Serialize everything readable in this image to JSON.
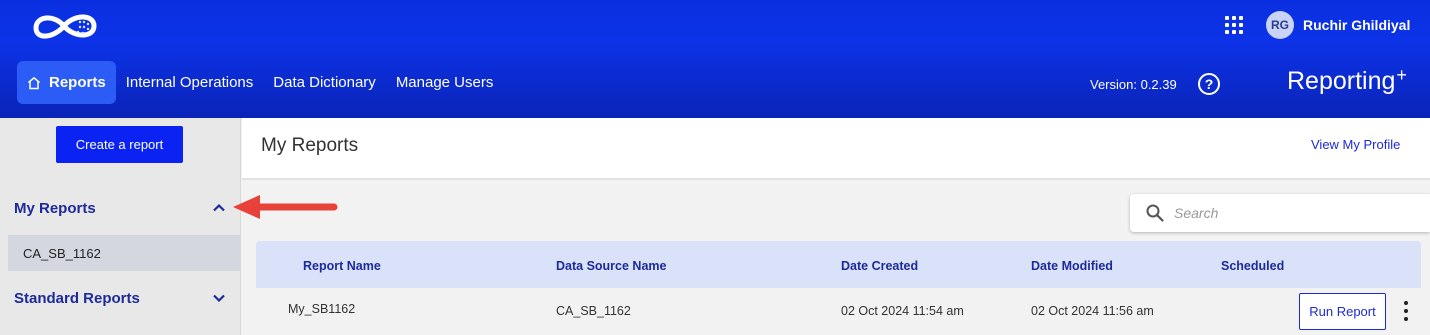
{
  "header": {
    "user_initials": "RG",
    "user_name": "Ruchir Ghildiyal",
    "version": "Version: 0.2.39",
    "brand": "Reporting",
    "brand_sup": "+",
    "logo_icon": "infinity-globe-logo",
    "apps_icon": "grid-apps-icon",
    "help_icon": "question-circle-icon"
  },
  "nav": {
    "items": [
      {
        "label": "Reports",
        "active": true,
        "icon": "home-icon"
      },
      {
        "label": "Internal Operations"
      },
      {
        "label": "Data Dictionary"
      },
      {
        "label": "Manage Users"
      }
    ]
  },
  "sidebar": {
    "create_label": "Create a report",
    "my_reports_label": "My Reports",
    "my_reports_items": [
      "CA_SB_1162"
    ],
    "standard_reports_label": "Standard Reports"
  },
  "main": {
    "title": "My Reports",
    "view_profile": "View My Profile",
    "search_placeholder": "Search"
  },
  "table": {
    "columns": [
      "Report Name",
      "Data Source Name",
      "Date Created",
      "Date Modified",
      "Scheduled"
    ],
    "rows": [
      {
        "report_name": "My_SB1162",
        "data_source": "CA_SB_1162",
        "date_created": "02 Oct 2024 11:54 am",
        "date_modified": "02 Oct 2024 11:56 am",
        "scheduled": "",
        "action": "Run Report"
      }
    ]
  },
  "colors": {
    "header_blue": "#0d33e8",
    "primary_button": "#0a22f2",
    "link_blue": "#1d2ad8",
    "heading_navy": "#1d2a9b",
    "arrow_red": "#e8413a"
  }
}
